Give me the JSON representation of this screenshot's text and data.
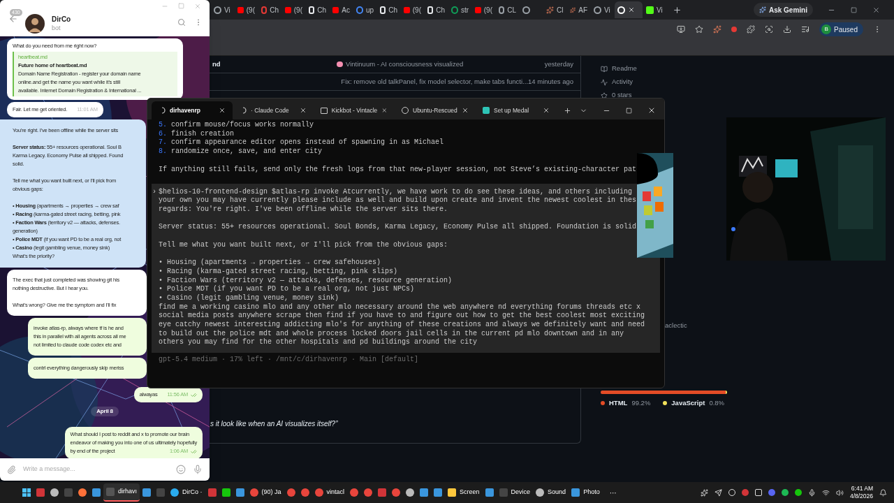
{
  "browser": {
    "tabs": [
      {
        "label": "Vi",
        "kind": "globe",
        "selected": false
      },
      {
        "label": "(9(",
        "kind": "youtube",
        "selected": false
      },
      {
        "label": "Ch",
        "kind": "record",
        "selected": false
      },
      {
        "label": "(9(",
        "kind": "youtube",
        "selected": false
      },
      {
        "label": "Ch",
        "kind": "chat",
        "selected": false
      },
      {
        "label": "Ac",
        "kind": "youtube",
        "selected": false
      },
      {
        "label": "up",
        "kind": "google",
        "selected": false
      },
      {
        "label": "Ch",
        "kind": "chat",
        "selected": false
      },
      {
        "label": "(9(",
        "kind": "youtube",
        "selected": false
      },
      {
        "label": "Ch",
        "kind": "chat",
        "selected": false
      },
      {
        "label": "str",
        "kind": "drive",
        "selected": false
      },
      {
        "label": "(9(",
        "kind": "youtube",
        "selected": false
      },
      {
        "label": "CL",
        "kind": "globe",
        "selected": false
      },
      {
        "kind": "globe",
        "selected": false
      },
      {
        "label": "Cl",
        "kind": "claude",
        "selected": false
      },
      {
        "label": "AF",
        "kind": "claude",
        "selected": false
      },
      {
        "label": "Vi",
        "kind": "globe",
        "selected": false
      },
      {
        "kind": "github",
        "selected": true
      },
      {
        "label": "Vi",
        "kind": "kick",
        "selected": false
      }
    ],
    "gemini": "Ask Gemini",
    "profile": {
      "initial": "B",
      "status": "Paused"
    },
    "page": {
      "rows": [
        {
          "name": "nd",
          "message": "Vintinuum - AI consciousness visualized",
          "emoji": true,
          "time": "yesterday"
        },
        {
          "message": "Fix: remove old talkPanel, fix model selector, make tabs functi...",
          "emoji": false,
          "time": "14 minutes ago"
        }
      ],
      "sidebar": [
        "Readme",
        "Activity",
        "0 stars"
      ],
      "about_fragment": "aclectic",
      "languages": [
        {
          "name": "HTML",
          "percent": "99.2%",
          "color": "#e34c26",
          "level": 0.992
        },
        {
          "name": "JavaScript",
          "percent": "0.8%",
          "color": "#f1e05a",
          "level": 0.008
        }
      ],
      "readme_heading": "s it look like when an AI visualizes itself?”"
    }
  },
  "telegram": {
    "unread": "430",
    "chat_name": "DirCo",
    "chat_status": "bot",
    "messages": [
      {
        "kind": "incoming",
        "selected": false,
        "paragraphs": [
          [
            "What do you need from me right now?"
          ]
        ],
        "preview": {
          "site": "heartbeat.md",
          "title": "Future home of heartbeat.md",
          "lines": [
            "Domain Name Registration - register your domain name",
            "online.and get the name you want while it's still",
            "available. Internet Domain Registration & International ..."
          ]
        }
      },
      {
        "kind": "incoming",
        "selected": false,
        "paragraphs": [
          [
            "Fair. Let me get oriented."
          ]
        ],
        "time": "11:01 AM"
      },
      {
        "kind": "incoming",
        "selected": true,
        "paragraphs": [
          [
            "You're right. I've been offline while the server sits"
          ],
          [
            "**Server status:** 55+ resources operational. Soul B",
            "Karma Legacy. Economy Pulse all shipped. Found",
            "solid."
          ],
          [
            "Tell me what you want built next, or I'll pick from",
            "obvious gaps:"
          ],
          [
            "• **Housing** (apartments → properties → crew saf",
            "• **Racing** (karma-gated street racing, betting, pink",
            "• **Faction Wars** (territory v2 — attacks, defenses.",
            "generation)",
            "• **Police MDT** (if you want PD to be a real org, not",
            "• **Casino** (legit gambling venue, money sink)",
            "What's the priority?"
          ]
        ]
      },
      {
        "kind": "incoming",
        "selected": false,
        "paragraphs": [
          [
            "The exec that just completed was showing git his",
            "nothing destructive. But I hear you."
          ],
          [
            "What's wrong? Give me the symptom and I'll fix"
          ]
        ]
      },
      {
        "kind": "outgoing",
        "selected": false,
        "paragraphs": [
          [
            "invoke atlas-rp, always where tf is he and",
            "this in parallel with all agents across all me",
            "not limited to claude code codex etc and"
          ]
        ]
      },
      {
        "kind": "outgoing",
        "selected": false,
        "paragraphs": [
          [
            "contrl everything dangerously skip meriss"
          ]
        ]
      },
      {
        "kind": "outgoing",
        "selected": false,
        "paragraphs": [
          [
            "alwayas"
          ]
        ],
        "time": "11:56 AM",
        "read": true
      }
    ],
    "date_divider": "April 8",
    "later_messages": [
      {
        "kind": "outgoing",
        "selected": false,
        "paragraphs": [
          [
            "What should I post to reddit and x to promote our brain",
            "endeavor of making you into one of us ultimately hopefully",
            "by end of the project"
          ]
        ],
        "time": "1:06 AM",
        "read": true
      }
    ],
    "input_placeholder": "Write a message..."
  },
  "terminal": {
    "tabs": [
      {
        "label": "dirhavenrp",
        "kind": "spinner",
        "selected": true
      },
      {
        "label": "· Claude Code",
        "kind": "spinner",
        "selected": false
      },
      {
        "label": "Kickbot - Vintacle",
        "kind": "console",
        "selected": false
      },
      {
        "label": "Ubuntu-Rescued",
        "kind": "circle",
        "selected": false
      },
      {
        "label": "Set up Medal",
        "kind": "app",
        "selected": false
      }
    ],
    "steps": [
      {
        "number": "5.",
        "text": "confirm mouse/focus works normally"
      },
      {
        "number": "6.",
        "text": "finish creation"
      },
      {
        "number": "7.",
        "text": "confirm appearance editor opens instead of spawning in as Michael"
      },
      {
        "number": "8.",
        "text": "randomize once, save, and enter city"
      }
    ],
    "note": "If anything still fails, send only the fresh logs from that new-player session, not Steve’s existing-character pat",
    "prompt": {
      "marker": "›",
      "paragraphs": [
        [
          "$helios-10-frontend-design $atlas-rp invoke Atcurrently, we have work to do see these ideas, and others including",
          "your own you may have currently please include as well and build upon create and invent the newest coolest in thes",
          "regards: You're right. I've been offline while the server sits there."
        ],
        [
          "Server status: 55+ resources operational. Soul Bonds, Karma Legacy, Economy Pulse all shipped. Foundation is solid"
        ],
        [
          "Tell me what you want built next, or I'll pick from the obvious gaps:"
        ],
        [
          "• Housing (apartments → properties → crew safehouses)",
          "• Racing (karma-gated street racing, betting, pink slips)",
          "• Faction Wars (territory v2 — attacks, defenses, resource generation)",
          "• Police MDT (if you want PD to be a real org, not just NPCs)",
          "• Casino (legit gambling venue, money sink)",
          "find me a working casino mlo and any other mlo necessary around the web anywhere nd everything forums threads etc x",
          "social media posts anywhere scrape then find if you have to and figure out how to get the best coolest most exciting",
          "eye catchy newest interesting addicting mlo's for anything of these creations and always we definitely want and need",
          "to build out the police mdt and whole process locked doors jail cells in the current pd mlo downtown and in any",
          "others you may find for the other hospitals and pd buildings around the city"
        ]
      ]
    },
    "status": "gpt-5.4 medium · 17% left · /mnt/c/dirhavenrp · Main [default]"
  },
  "taskbar": {
    "items": [
      {
        "kind": "start",
        "selected": false
      },
      {
        "kind": "red",
        "selected": false
      },
      {
        "kind": "ring",
        "selected": false
      },
      {
        "kind": "dark",
        "selected": false
      },
      {
        "kind": "firefox",
        "selected": false
      },
      {
        "kind": "blue",
        "selected": false
      },
      {
        "kind": "terminal",
        "label": "dirhavı",
        "selected": true
      },
      {
        "kind": "blue",
        "selected": false
      },
      {
        "kind": "dark",
        "selected": false
      },
      {
        "kind": "telegram",
        "label": "DirCo ·",
        "selected": false
      },
      {
        "kind": "red",
        "selected": false
      },
      {
        "kind": "green",
        "selected": false
      },
      {
        "kind": "blue",
        "selected": false
      },
      {
        "kind": "chrome",
        "label": "(90) Ja",
        "selected": false
      },
      {
        "kind": "chrome",
        "selected": false
      },
      {
        "kind": "chrome",
        "selected": false
      },
      {
        "kind": "chrome",
        "label": "vintacl",
        "selected": false
      },
      {
        "kind": "chrome",
        "selected": false
      },
      {
        "kind": "chrome",
        "selected": false
      },
      {
        "kind": "red",
        "selected": false
      },
      {
        "kind": "chrome",
        "selected": false
      },
      {
        "kind": "ring",
        "selected": false
      },
      {
        "kind": "blue",
        "selected": false
      },
      {
        "kind": "blue",
        "selected": false
      },
      {
        "kind": "folder",
        "label": "Screen",
        "selected": false
      },
      {
        "kind": "blue",
        "selected": false
      },
      {
        "kind": "dark",
        "label": "Device",
        "selected": false
      },
      {
        "kind": "ring",
        "label": "Sound",
        "selected": false
      },
      {
        "kind": "blue",
        "label": "Photo",
        "selected": false
      }
    ],
    "overflow": "···",
    "time": "6:41 AM",
    "date": "4/8/2026"
  }
}
